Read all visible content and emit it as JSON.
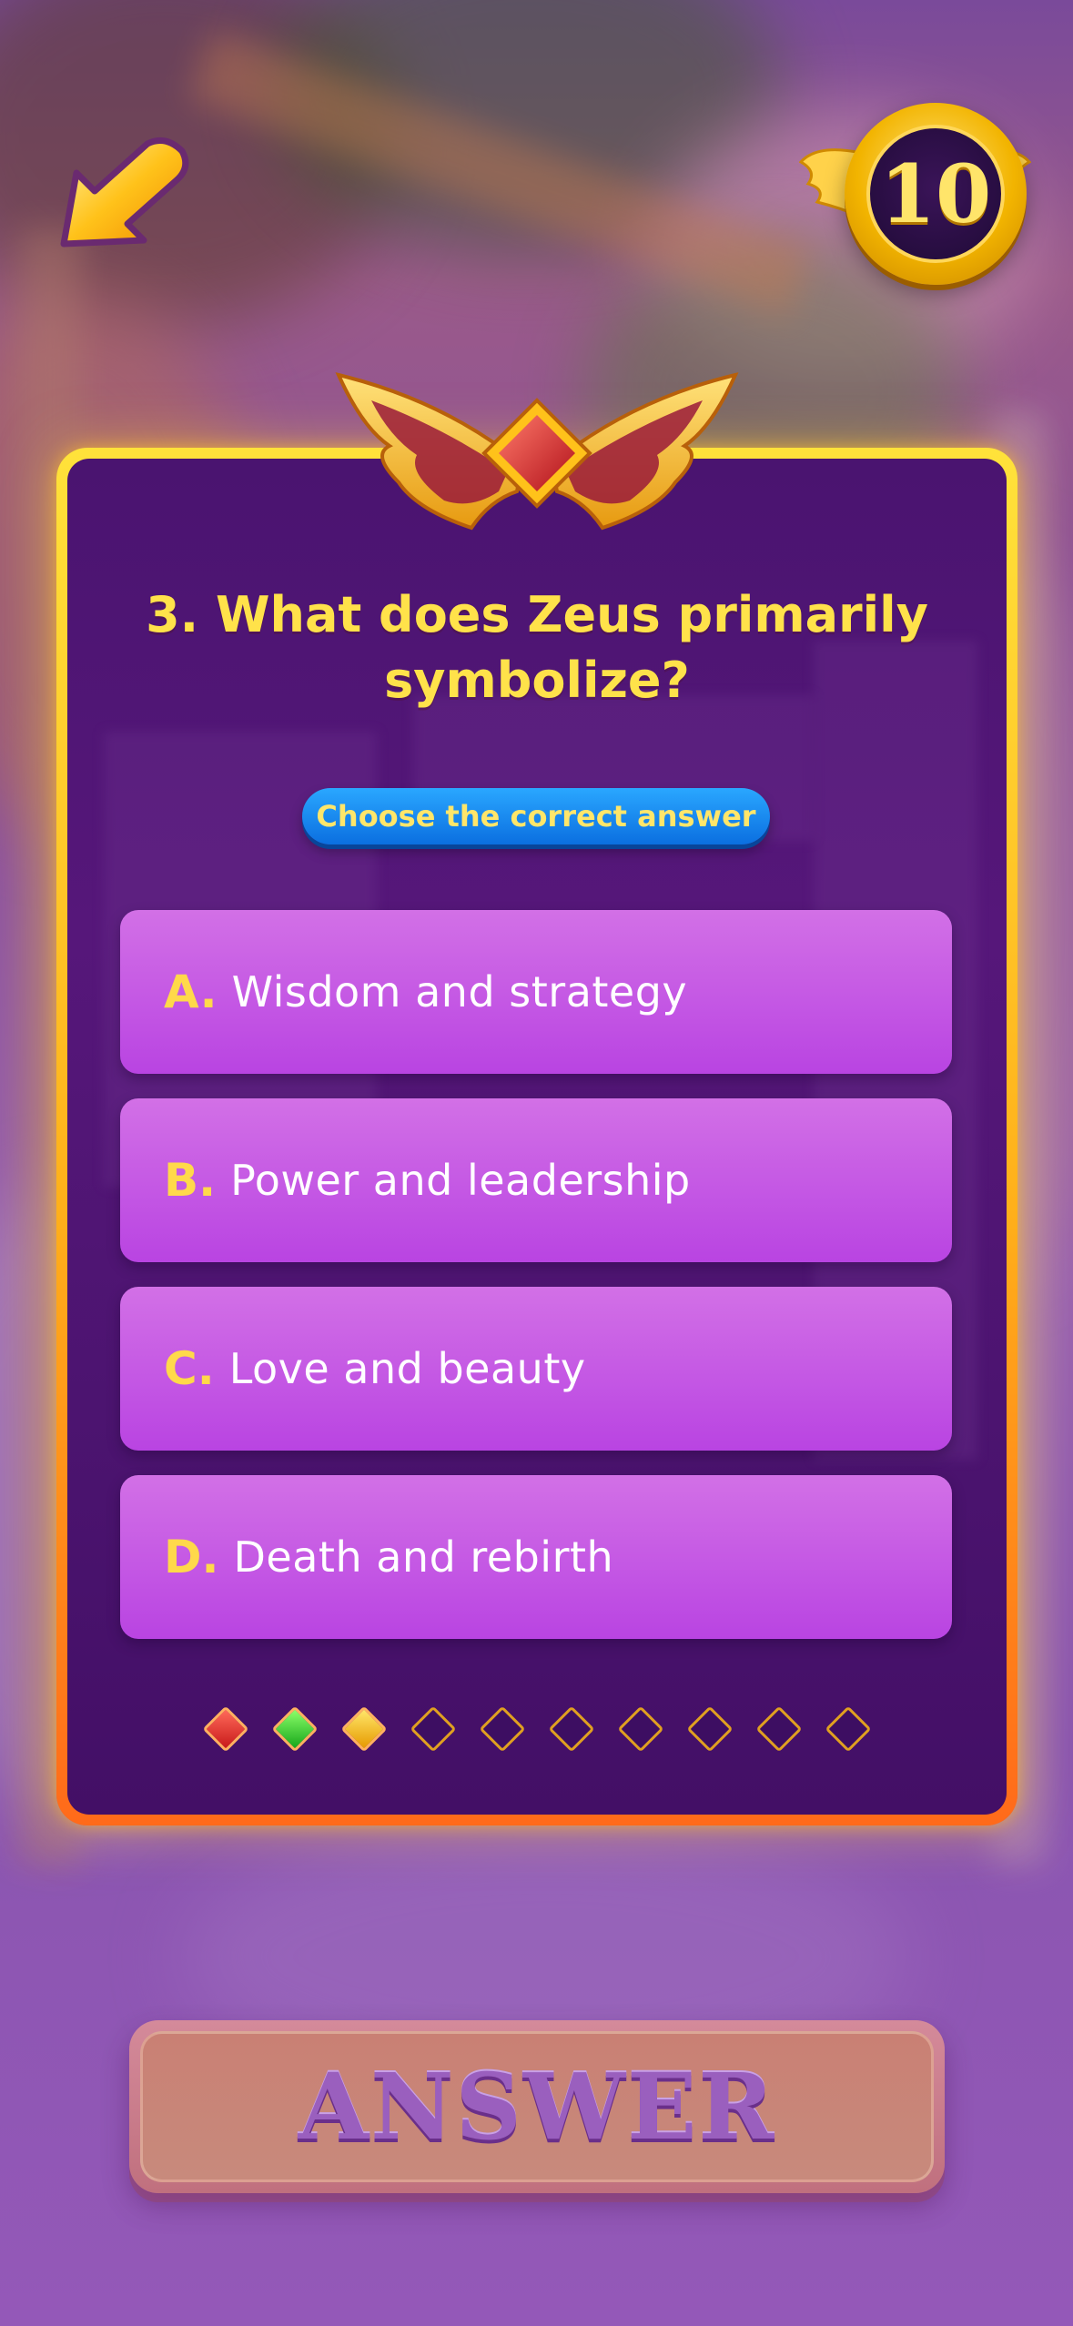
{
  "header": {
    "back_icon": "back-arrow-icon",
    "score": "10"
  },
  "quiz": {
    "question": "3. What does Zeus primarily symbolize?",
    "instruction": "Choose the correct answer",
    "answers": [
      {
        "letter": "A.",
        "text": "Wisdom and strategy"
      },
      {
        "letter": "B.",
        "text": "Power and leadership"
      },
      {
        "letter": "C.",
        "text": "Love and beauty"
      },
      {
        "letter": "D.",
        "text": "Death and rebirth"
      }
    ],
    "progress": {
      "total": 10,
      "states": [
        "red",
        "green",
        "gold",
        "empty",
        "empty",
        "empty",
        "empty",
        "empty",
        "empty",
        "empty"
      ]
    }
  },
  "footer": {
    "answer_label": "ANSWER"
  },
  "colors": {
    "card_border": "#ffd23a",
    "card_bg": "#4a1470",
    "answer_bg": "#c65ae4",
    "question_text": "#ffe24a",
    "hint_pill": "#1a8aff"
  }
}
